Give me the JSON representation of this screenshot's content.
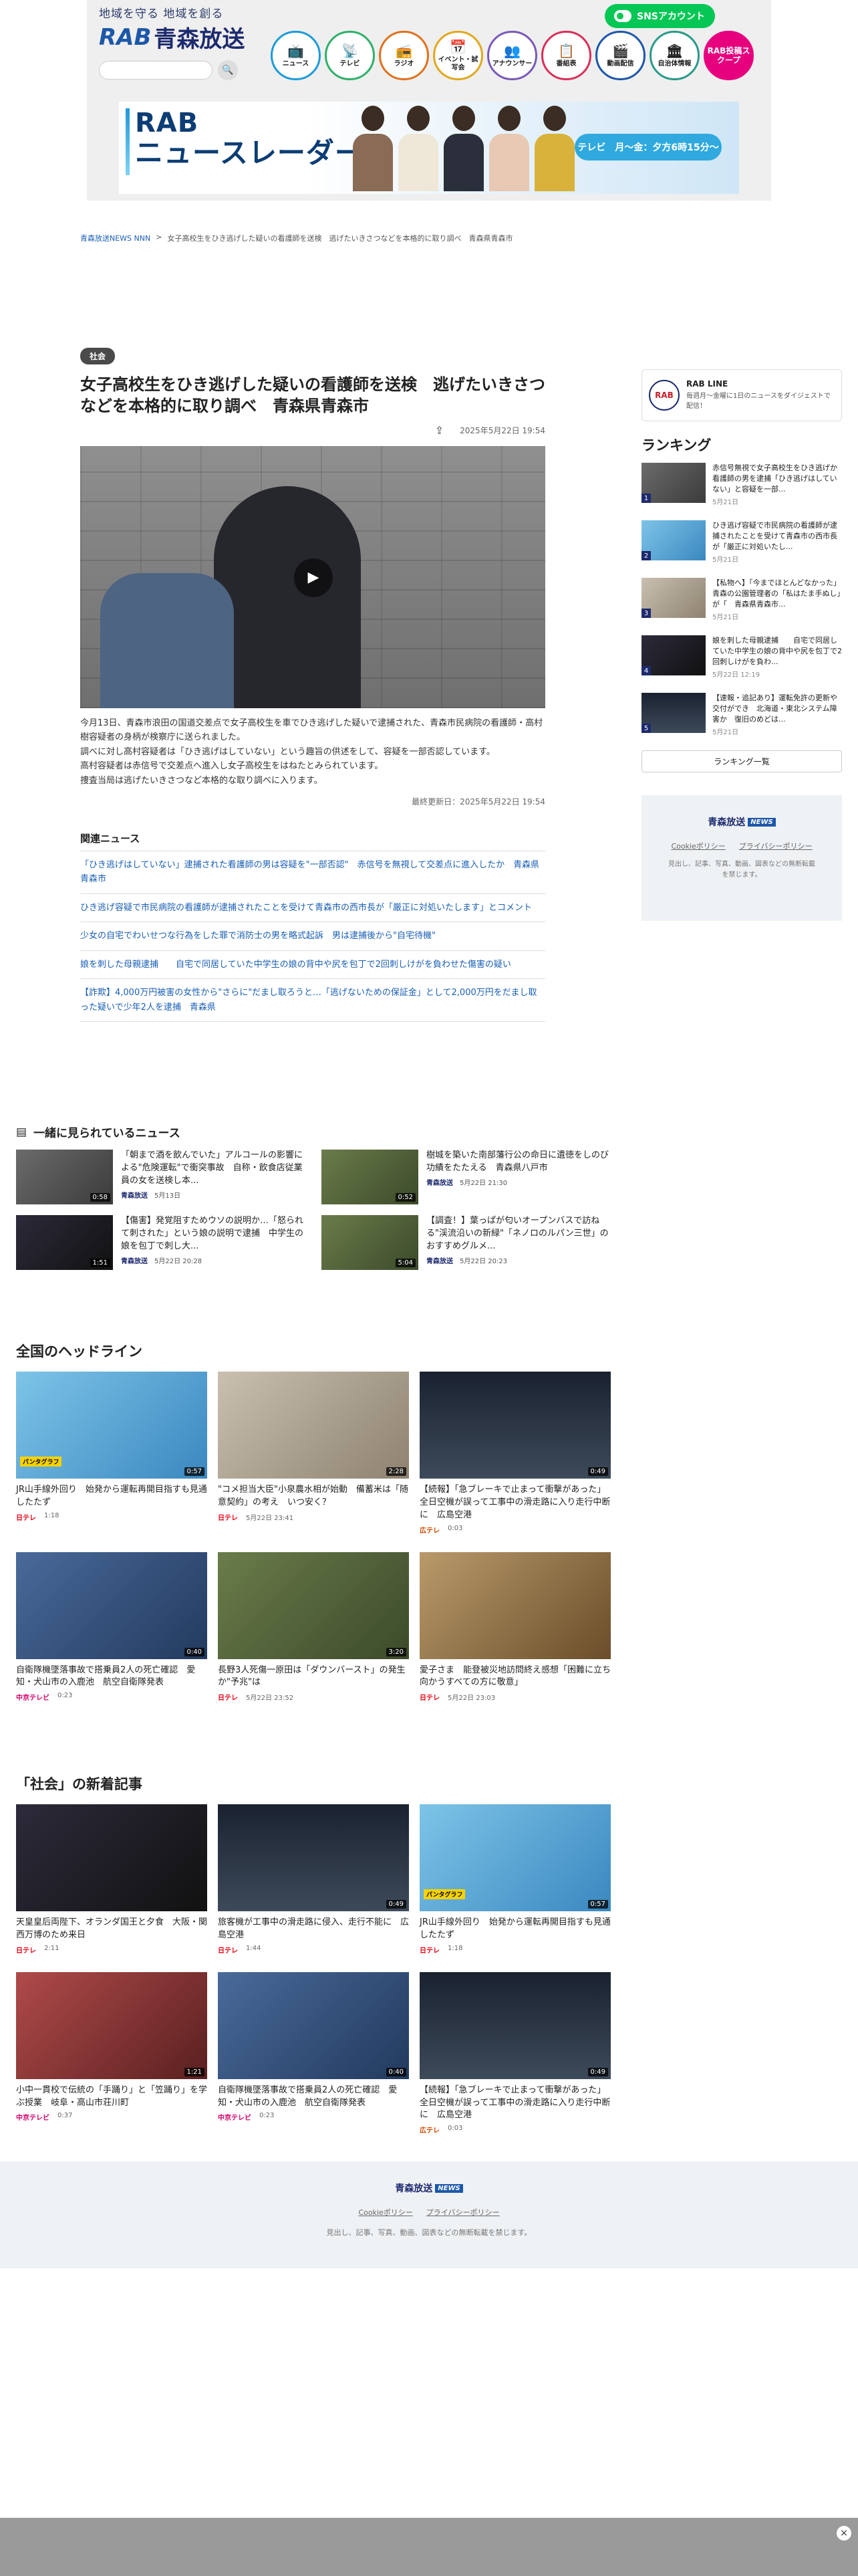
{
  "header": {
    "tagline": "地域を守る 地域を創る",
    "logo_rab": "RAB",
    "logo_name": "青森放送",
    "sns_button": "SNSアカウント",
    "nav": [
      {
        "label": "ニュース",
        "icon": "tv-icon",
        "glyph": "📺"
      },
      {
        "label": "テレビ",
        "icon": "television-icon",
        "glyph": "📡"
      },
      {
        "label": "ラジオ",
        "icon": "radio-icon",
        "glyph": "📻"
      },
      {
        "label": "イベント・試写会",
        "icon": "calendar-icon",
        "glyph": "📅"
      },
      {
        "label": "アナウンサー",
        "icon": "people-icon",
        "glyph": "👥"
      },
      {
        "label": "番組表",
        "icon": "guide-icon",
        "glyph": "📋"
      },
      {
        "label": "動画配信",
        "icon": "video-icon",
        "glyph": "🎬"
      },
      {
        "label": "自治体情報",
        "icon": "building-icon",
        "glyph": "🏛"
      },
      {
        "label": "RAB投稿スクープ",
        "icon": "scoop-icon",
        "glyph": ""
      }
    ],
    "banner_title_1": "RAB",
    "banner_title_2": "ニュースレーダー",
    "banner_time": "テレビ　月〜金：夕方6時15分〜"
  },
  "breadcrumb": {
    "home": "青森放送NEWS NNN",
    "sep": ">",
    "current": "女子高校生をひき逃げした疑いの看護師を送検　逃げたいきさつなどを本格的に取り調べ　青森県青森市"
  },
  "article": {
    "category": "社会",
    "title": "女子高校生をひき逃げした疑いの看護師を送検　逃げたいきさつなどを本格的に取り調べ　青森県青森市",
    "date": "2025年5月22日 19:54",
    "body": [
      "今月13日、青森市浪田の国道交差点で女子高校生を車でひき逃げした疑いで逮捕された、青森市民病院の看護師・高村樹容疑者の身柄が検察庁に送られました。",
      "調べに対し高村容疑者は「ひき逃げはしていない」という趣旨の供述をして、容疑を一部否認しています。",
      "高村容疑者は赤信号で交差点へ進入し女子高校生をはねたとみられています。",
      "捜査当局は逃げたいきさつなど本格的な取り調べに入ります。"
    ],
    "updated": "最終更新日：2025年5月22日 19:54"
  },
  "related": {
    "title": "関連ニュース",
    "items": [
      "「ひき逃げはしていない」逮捕された看護師の男は容疑を\"一部否認\"　赤信号を無視して交差点に進入したか　青森県青森市",
      "ひき逃げ容疑で市民病院の看護師が逮捕されたことを受けて青森市の西市長が「厳正に対処いたします」とコメント",
      "少女の自宅でわいせつな行為をした罪で消防士の男を略式起訴　男は逮捕後から\"自宅待機\"",
      "娘を刺した母親逮捕　　自宅で同居していた中学生の娘の背中や尻を包丁で2回刺しけがを負わせた傷害の疑い",
      "【詐欺】4,000万円被害の女性から\"さらに\"だまし取ろうと…「逃げないための保証金」として2,000万円をだまし取った疑いで少年2人を逮捕　青森県"
    ]
  },
  "sidebar": {
    "line_logo": "RAB",
    "line_name": "RAB LINE",
    "line_desc": "毎週月〜金曜に1日のニュースをダイジェストで配信！",
    "ranking_title": "ランキング",
    "ranking": [
      {
        "num": "1",
        "text": "赤信号無視で女子高校生をひき逃げか　看護師の男を逮捕「ひき逃げはしていない」と容疑を一部...",
        "date": "5月21日"
      },
      {
        "num": "2",
        "text": "ひき逃げ容疑で市民病院の看護師が逮捕されたことを受けて青森市の西市長が「厳正に対処いたし...",
        "date": "5月21日"
      },
      {
        "num": "3",
        "text": "【私物へ】「今までほとんどなかった」青森の公園管理者の「私はたま手ぬし」が「　青森県青森市...",
        "date": "5月21日"
      },
      {
        "num": "4",
        "text": "娘を刺した母親逮捕　　自宅で同居していた中学生の娘の背中や尻を包丁で2回刺しけがを負わ...",
        "date": "5月22日 12:19"
      },
      {
        "num": "5",
        "text": "【速報・追記あり】運転免許の更新や交付ができ　北海道・東北システム障害か　復旧のめどは...",
        "date": "5月21日"
      }
    ],
    "ranking_more": "ランキング一覧",
    "footer_logo": "青森放送",
    "footer_logo_tag": "NEWS",
    "footer_links": [
      "Cookieポリシー",
      "プライバシーポリシー"
    ],
    "footer_copy": "見出し、記事、写真、動画、図表などの無断転載を禁じます。"
  },
  "also": {
    "title": "一緒に見られているニュース",
    "items": [
      {
        "text": "「朝まで酒を飲んでいた」アルコールの影響による\"危険運転\"で衝突事故　自称・飲食店従業員の女を送検し本...",
        "src": "青森放送",
        "date": "5月13日",
        "dur": "0:58",
        "thumb": "t-grey"
      },
      {
        "text": "樹城を築いた南部藩行公の命日に遺徳をしのび功績をたたえる　青森県八戸市",
        "src": "青森放送",
        "date": "5月22日 21:30",
        "dur": "0:52",
        "thumb": "t-green"
      },
      {
        "text": "【傷害】発覚阻すためウソの説明か…「怒られて刺された」という娘の説明で逮捕　中学生の娘を包丁で刺し大...",
        "src": "青森放送",
        "date": "5月22日 20:28",
        "dur": "1:51",
        "thumb": "t-dark"
      },
      {
        "text": "【調査！】葉っぱが匂いオープンバスで訪ねる\"渓流沿いの新緑\"「ネノロのルパン三世」のおすすめグルメ...",
        "src": "青森放送",
        "date": "5月22日 20:23",
        "dur": "5:04",
        "thumb": "t-green"
      }
    ]
  },
  "national": {
    "title": "全国のヘッドライン",
    "items": [
      {
        "text": "JR山手線外回り　始発から運転再開目指すも見通したたず",
        "src": "日テレ",
        "date": "1:18",
        "dur": "0:57",
        "thumb": "t-sky",
        "cap": "パンタグラフ"
      },
      {
        "text": "\"コメ担当大臣\"小泉農水相が始動　備蓄米は「随意契約」の考え　いつ安く？",
        "src": "日テレ",
        "date": "5月22日 23:41",
        "dur": "2:28",
        "thumb": "t-light",
        "cap": ""
      },
      {
        "text": "【続報】「急ブレーキで止まって衝撃があった」全日空機が誤って工事中の滑走路に入り走行中断に　広島空港",
        "src": "広テレ",
        "date": "0:03",
        "dur": "0:49",
        "thumb": "t-night",
        "cap": ""
      },
      {
        "text": "自衛隊機墜落事故で搭乗員2人の死亡確認　愛知・犬山市の入鹿池　航空自衛隊発表",
        "src": "中京テレビ",
        "date": "0:23",
        "dur": "0:40",
        "thumb": "t-blue",
        "cap": ""
      },
      {
        "text": "長野3人死傷一原田は「ダウンバースト」の発生か\"予兆\"は",
        "src": "日テレ",
        "date": "5月22日 23:52",
        "dur": "3:20",
        "thumb": "t-green",
        "cap": ""
      },
      {
        "text": "愛子さま　能登被災地訪問終え感想「困難に立ち向かうすべての方に敬意」",
        "src": "日テレ",
        "date": "5月22日 23:03",
        "dur": "",
        "thumb": "t-warm",
        "cap": ""
      }
    ]
  },
  "social": {
    "title": "「社会」の新着記事",
    "items": [
      {
        "text": "天皇皇后両陛下、オランダ国王と夕食　大阪・関西万博のため来日",
        "src": "日テレ",
        "date": "2:11",
        "dur": "",
        "thumb": "t-dark",
        "cap": ""
      },
      {
        "text": "旅客機が工事中の滑走路に侵入、走行不能に　広島空港",
        "src": "日テレ",
        "date": "1:44",
        "dur": "0:49",
        "thumb": "t-night",
        "cap": ""
      },
      {
        "text": "JR山手線外回り　始発から運転再開目指すも見通したたず",
        "src": "日テレ",
        "date": "1:18",
        "dur": "0:57",
        "thumb": "t-sky",
        "cap": "パンタグラフ"
      },
      {
        "text": "小中一貫校で伝統の「手踊り」と「笠踊り」を学ぶ授業　岐阜・高山市荘川町",
        "src": "中京テレビ",
        "date": "0:37",
        "dur": "1:21",
        "thumb": "t-red",
        "cap": ""
      },
      {
        "text": "自衛隊機墜落事故で搭乗員2人の死亡確認　愛知・犬山市の入鹿池　航空自衛隊発表",
        "src": "中京テレビ",
        "date": "0:23",
        "dur": "0:40",
        "thumb": "t-blue",
        "cap": ""
      },
      {
        "text": "【続報】「急ブレーキで止まって衝撃があった」全日空機が誤って工事中の滑走路に入り走行中断に　広島空港",
        "src": "広テレ",
        "date": "0:03",
        "dur": "0:49",
        "thumb": "t-night",
        "cap": ""
      }
    ]
  },
  "page_footer": {
    "logo": "青森放送",
    "logo_tag": "NEWS",
    "links": [
      "Cookieポリシー",
      "プライバシーポリシー"
    ],
    "copy": "見出し、記事、写真、動画、図表などの無断転載を禁じます。"
  },
  "ad": {
    "close": "×"
  }
}
